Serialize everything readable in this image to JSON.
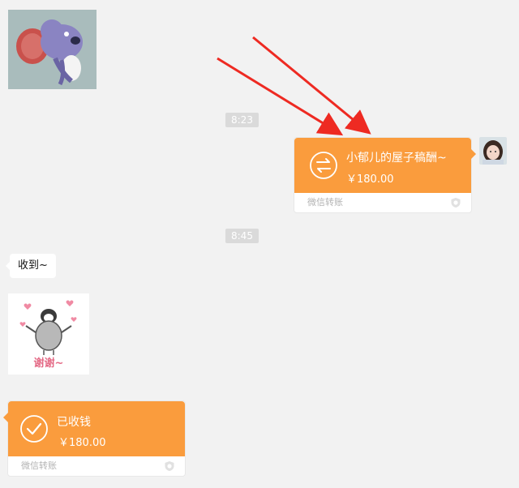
{
  "messages": {
    "time_1": "8:23",
    "time_2": "8:45",
    "received_text": "收到~",
    "sticker_2_caption": "谢谢~"
  },
  "transfer_sent": {
    "title": "小郁儿的屋子稿酬~",
    "amount": "￥180.00",
    "footer": "微信转账",
    "icon": "transfer-arrows-icon"
  },
  "transfer_received": {
    "title": "已收钱",
    "amount": "￥180.00",
    "footer": "微信转账",
    "icon": "checkmark-icon"
  },
  "colors": {
    "background": "#f2f2f2",
    "transfer_orange": "#fa9c3d",
    "annotation_arrow": "#ee2a22"
  }
}
